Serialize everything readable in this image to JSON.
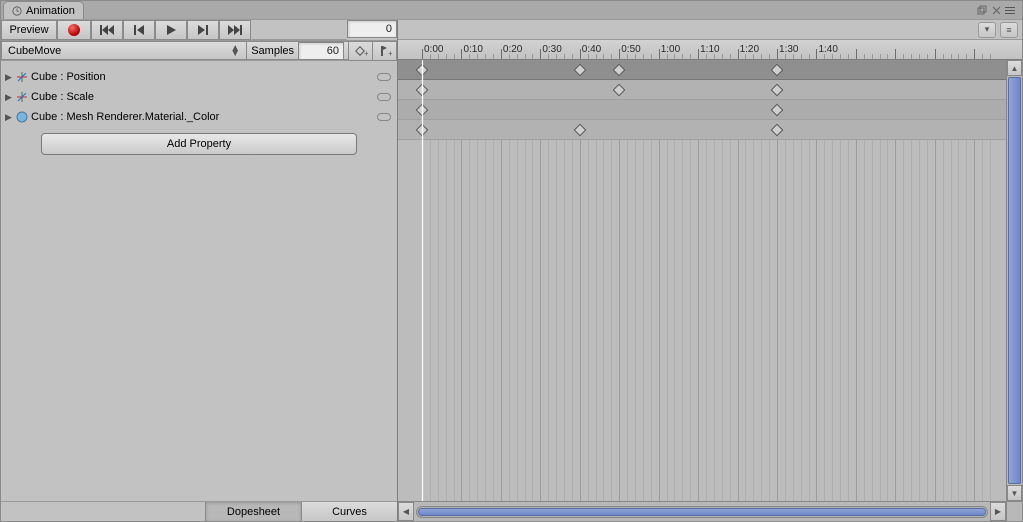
{
  "window": {
    "title": "Animation"
  },
  "toolbar": {
    "preview_label": "Preview",
    "frame_value": "0"
  },
  "clip": {
    "selected": "CubeMove",
    "samples_label": "Samples",
    "samples_value": "60"
  },
  "properties": [
    {
      "label": "Cube : Position",
      "icon": "transform"
    },
    {
      "label": "Cube : Scale",
      "icon": "transform"
    },
    {
      "label": "Cube : Mesh Renderer.Material._Color",
      "icon": "material"
    }
  ],
  "add_property_label": "Add Property",
  "modes": {
    "dopesheet": "Dopesheet",
    "curves": "Curves",
    "active": "dopesheet"
  },
  "timeline": {
    "start": 0,
    "end": 145,
    "major_tick_interval": 10,
    "labels": [
      "0:00",
      "0:10",
      "0:20",
      "0:30",
      "0:40",
      "0:50",
      "1:00",
      "1:10",
      "1:20",
      "1:30",
      "1:40"
    ],
    "playhead_frame": 0,
    "summary_keys": [
      0,
      40,
      50,
      90
    ],
    "track_keys": [
      [
        0,
        50,
        90
      ],
      [
        0,
        90
      ],
      [
        0,
        40,
        90
      ]
    ]
  }
}
